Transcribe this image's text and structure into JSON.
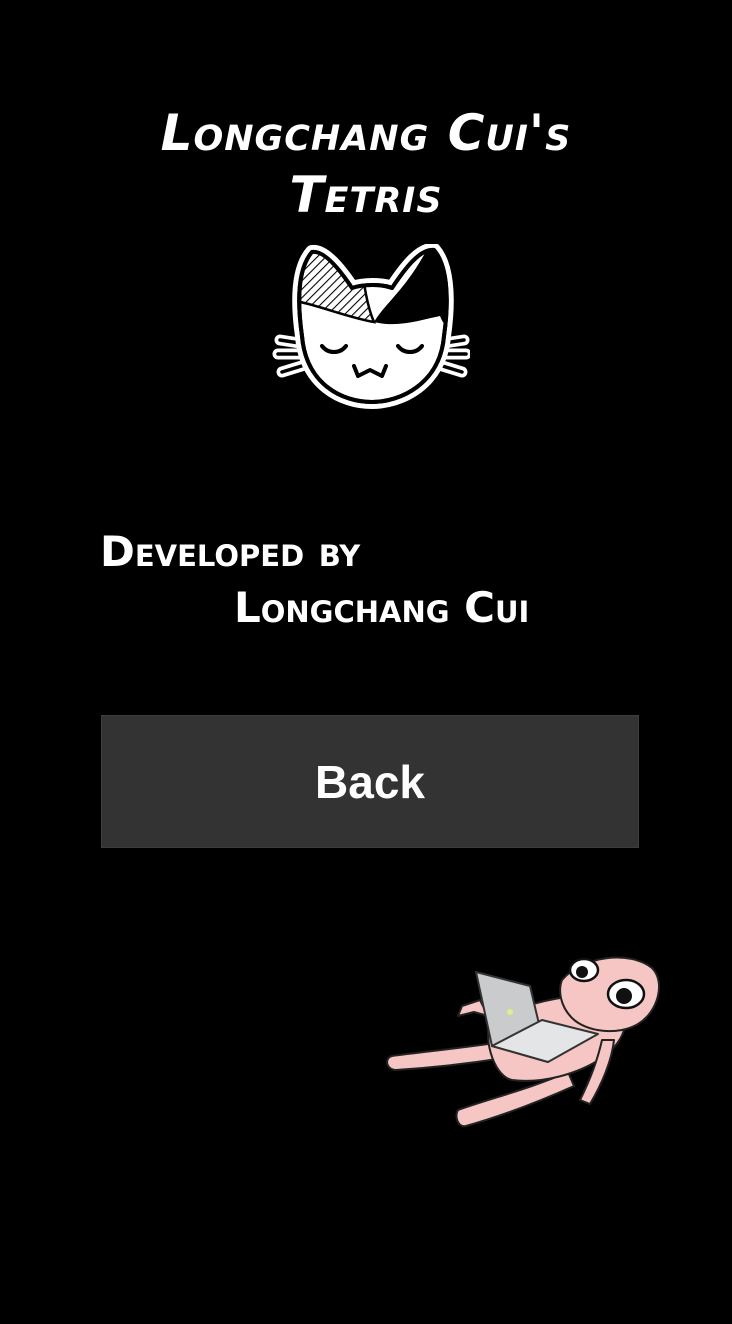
{
  "title": {
    "line1": "Longchang Cui's",
    "line2": "Tetris"
  },
  "credits": {
    "line1": "Developed by",
    "line2": "Longchang Cui"
  },
  "back_button": {
    "label": "Back"
  },
  "icons": {
    "logo": "sleeping-cat-icon",
    "mascot": "character-with-laptop-icon"
  },
  "colors": {
    "background": "#000000",
    "text": "#ffffff",
    "button": "#333333",
    "character_skin": "#f6c6c4"
  }
}
